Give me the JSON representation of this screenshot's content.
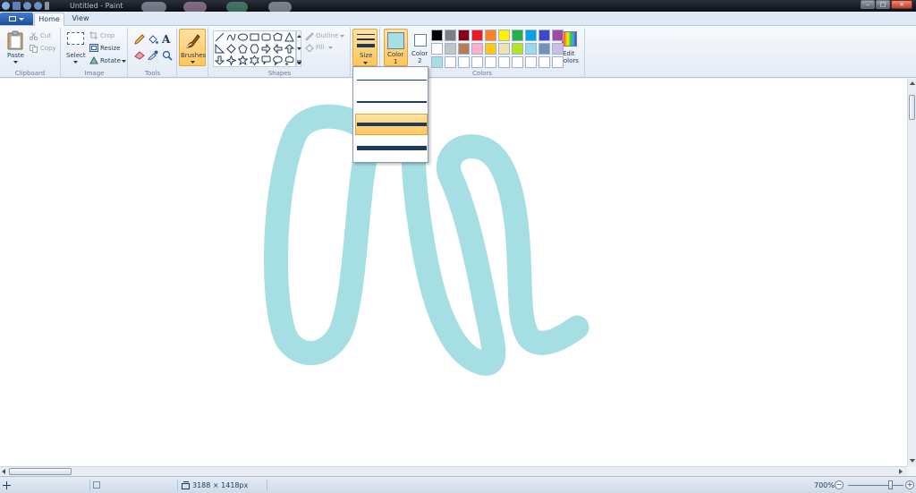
{
  "window": {
    "title": "Untitled - Paint"
  },
  "tabs": {
    "home": "Home",
    "view": "View"
  },
  "clipboard": {
    "paste": "Paste",
    "cut": "Cut",
    "copy": "Copy",
    "label": "Clipboard"
  },
  "image": {
    "select": "Select",
    "crop": "Crop",
    "resize": "Resize",
    "rotate": "Rotate",
    "label": "Image"
  },
  "tools": {
    "label": "Tools",
    "text_glyph": "A"
  },
  "brushes": {
    "label": "Brushes"
  },
  "shapes": {
    "outline": "Outline",
    "fill": "Fill",
    "label": "Shapes"
  },
  "size": {
    "label": "Size",
    "options": [
      1,
      2,
      4,
      5
    ],
    "selected_index": 2
  },
  "colors": {
    "color1_label": "Color",
    "color1_num": "1",
    "color2_label": "Color",
    "color2_num": "2",
    "edit_line1": "Edit",
    "edit_line2": "colors",
    "label": "Colors",
    "color1_value": "#a6dfe3",
    "color2_value": "#ffffff",
    "palette": [
      "#000000",
      "#7f7f7f",
      "#880015",
      "#ed1c24",
      "#ff7f27",
      "#fff200",
      "#22b14c",
      "#00a2e8",
      "#3f48cc",
      "#a349a4",
      "#ffffff",
      "#c3c3c3",
      "#b97a57",
      "#ffaec9",
      "#ffc90e",
      "#efe4b0",
      "#b5e61d",
      "#99d9ea",
      "#7092be",
      "#c8bfe7",
      "#a6dfe3",
      "#ffffff",
      "#ffffff",
      "#ffffff",
      "#ffffff",
      "#ffffff",
      "#ffffff",
      "#ffffff",
      "#ffffff",
      "#ffffff"
    ]
  },
  "canvas": {
    "stroke_color": "#a6dfe3"
  },
  "status": {
    "dimensions": "3188 × 1418px",
    "zoom": "700%"
  }
}
